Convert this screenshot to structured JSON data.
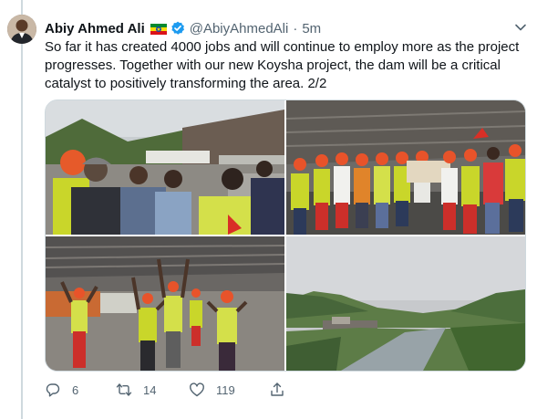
{
  "tweet": {
    "author_name": "Abiy Ahmed Ali",
    "handle": "@AbiyAhmedAli",
    "separator": "·",
    "time": "5m",
    "text": "So far it has created 4000 jobs and will continue to employ more as the project progresses. Together with our new Koysha project, the dam will be a critical catalyst to positively transforming the area. 2/2",
    "flag_icon": "ethiopia-flag-icon",
    "verified_icon": "verified-badge-icon",
    "accent_color": "#1d9bf0"
  },
  "media": {
    "photos": [
      {
        "subject": "officials-at-dam-site"
      },
      {
        "subject": "workers-in-hard-hats-holding-sign"
      },
      {
        "subject": "workers-waving-in-quarry"
      },
      {
        "subject": "river-valley-with-green-hills"
      }
    ]
  },
  "actions": {
    "reply_count": "6",
    "retweet_count": "14",
    "like_count": "119"
  }
}
